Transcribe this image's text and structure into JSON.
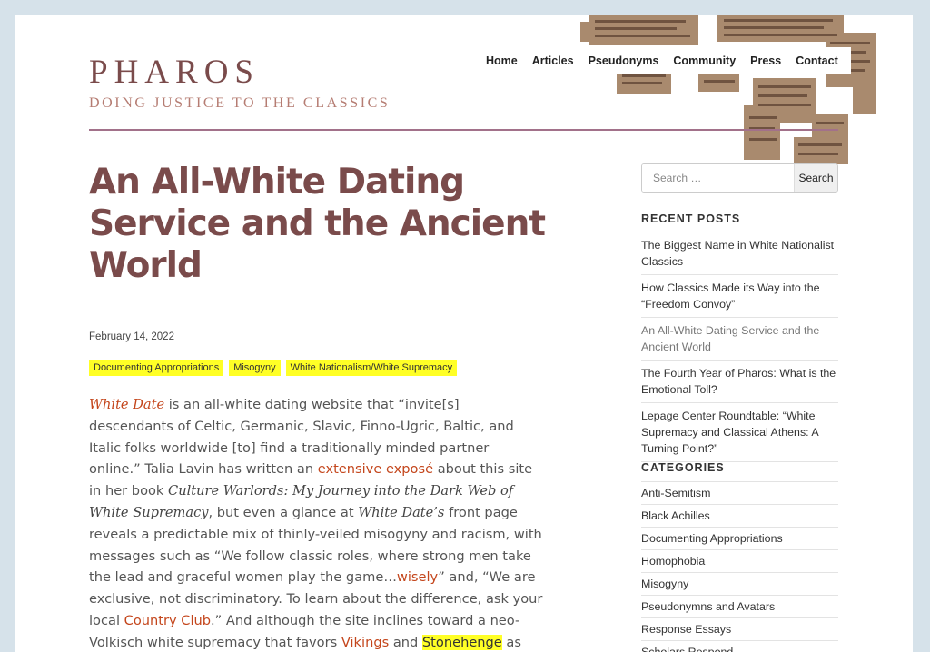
{
  "site": {
    "title": "PHAROS",
    "tagline": "DOING JUSTICE TO THE CLASSICS"
  },
  "nav": {
    "items": [
      "Home",
      "Articles",
      "Pseudonyms",
      "Community",
      "Press",
      "Contact"
    ]
  },
  "post": {
    "title": "An All-White Dating Service and the Ancient World",
    "date": "February 14, 2022",
    "tags": [
      "Documenting Appropriations",
      "Misogyny",
      "White Nationalism/White Supremacy"
    ],
    "body": {
      "link_white_date": "White Date",
      "t1": " is an all-white dating website that “invite[s] descendants of Celtic, Germanic, Slavic, Finno-Ugric, Baltic, and Italic folks worldwide [to] find a traditionally minded partner online.” Talia Lavin has written an ",
      "link_expose": "extensive exposé",
      "t2": " about this site in her book ",
      "book_title": "Culture Warlords: My Journey into the Dark Web of White Supremacy",
      "t3": ", but even a glance at ",
      "white_date_poss": "White Date’s",
      "t4": " front page reveals a predictable mix of thinly-veiled misogyny and racism, with messages such as “We follow classic roles, where strong men take the lead and graceful women play the game…",
      "link_wisely": "wisely",
      "t5": "” and, “We are exclusive, not discriminatory. To learn about the difference, ask your local ",
      "link_country_club": "Country Club",
      "t6": ".” And although the site inclines toward a ",
      "link_neo_volkisch": "neo-Volkisch",
      "t7": " white supremacy that favors ",
      "link_vikings": "Vikings",
      "t8": " and ",
      "link_stonehenge": "Stonehenge",
      "t9": " as historical symbols, ancient"
    }
  },
  "sidebar": {
    "search": {
      "placeholder": "Search …",
      "button": "Search"
    },
    "recent_posts": {
      "title": "RECENT POSTS",
      "items": [
        "The Biggest Name in White Nationalist Classics",
        "How Classics Made its Way into the “Freedom Convoy”",
        "An All-White Dating Service and the Ancient World",
        "The Fourth Year of Pharos: What is the Emotional Toll?",
        "Lepage Center Roundtable: “White Supremacy and Classical Athens: A Turning Point?”"
      ]
    },
    "categories": {
      "title": "CATEGORIES",
      "items": [
        "Anti-Semitism",
        "Black Achilles",
        "Documenting Appropriations",
        "Homophobia",
        "Misogyny",
        "Pseudonymns and Avatars",
        "Response Essays",
        "Scholars Respond"
      ]
    }
  },
  "colors": {
    "title": "#7a4b4b",
    "tagline": "#b57c72",
    "link": "#c4461c",
    "highlight": "#ffff26",
    "page_bg": "#d6e2ea"
  }
}
